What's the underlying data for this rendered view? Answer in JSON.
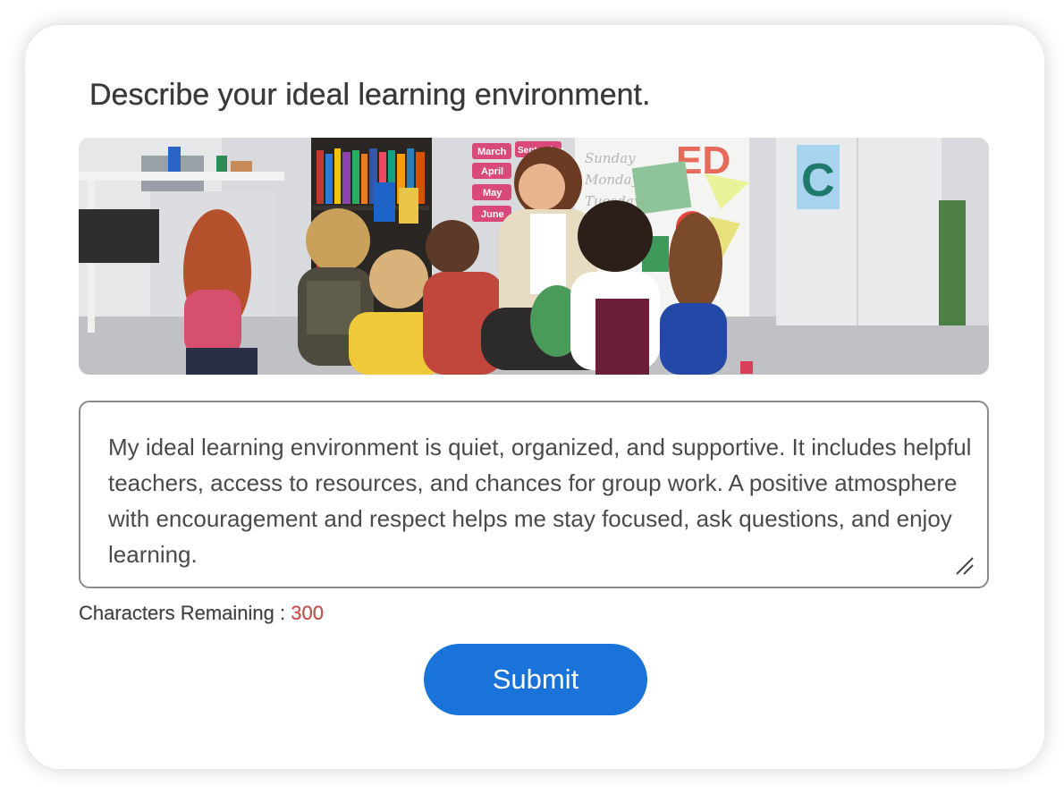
{
  "question": {
    "title": "Describe your ideal learning environment."
  },
  "photo": {
    "alt": "Teacher and children sitting on classroom floor",
    "calendar_months": [
      "March",
      "April",
      "May",
      "June"
    ],
    "calendar_month_partial": "September",
    "whiteboard_words": [
      "Sunday",
      "Monday",
      "Tuesday"
    ],
    "letter_card": "C",
    "wall_letters": "ED"
  },
  "answer": {
    "text": "My ideal learning environment is quiet, organized, and supportive. It includes helpful teachers, access to resources, and chances for group work. A positive atmosphere with encouragement and respect helps me stay focused, ask questions, and enjoy learning."
  },
  "counter": {
    "label": "Characters Remaining : ",
    "value": "300"
  },
  "submit": {
    "label": "Submit"
  },
  "colors": {
    "accent": "#1a73d9",
    "counter_value": "#e0504a",
    "text": "#3a3a3a"
  }
}
